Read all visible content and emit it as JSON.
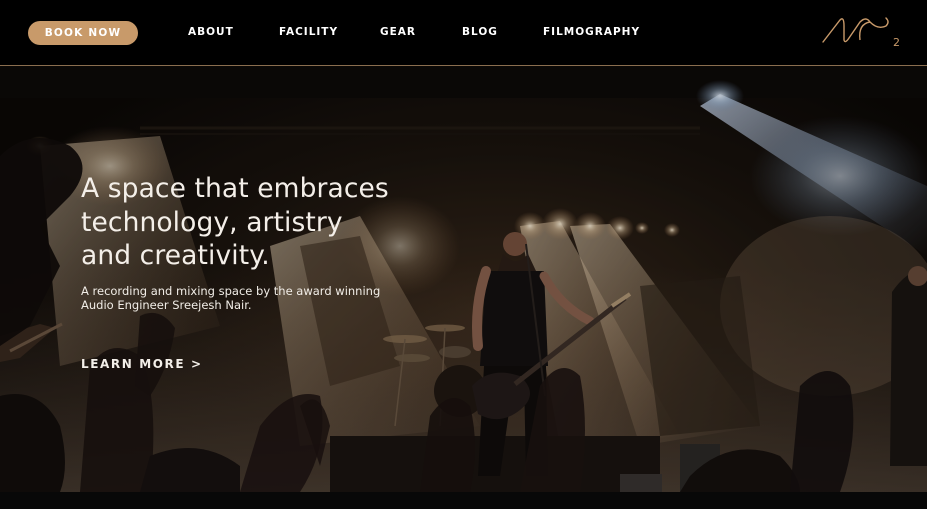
{
  "nav": {
    "book_now": "BOOK NOW",
    "links": [
      "ABOUT",
      "FACILITY",
      "GEAR",
      "BLOG",
      "FILMOGRAPHY"
    ],
    "logo_text": "2"
  },
  "hero": {
    "headline": [
      "A space that embraces",
      "technology, artistry",
      "and creativity."
    ],
    "subtext": "A recording and mixing space by the award winning Audio Engineer Sreejesh Nair.",
    "cta": "LEARN MORE >"
  },
  "colors": {
    "accent": "#c89a6a",
    "nav_bg": "#000000",
    "divider": "#8a6e4f"
  },
  "icons": {
    "logo": "brand-logo-icon",
    "hero_image": "concert-stage-photo"
  }
}
